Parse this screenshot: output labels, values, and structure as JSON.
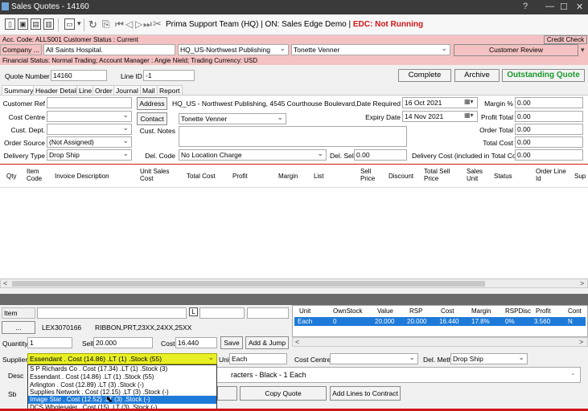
{
  "window": {
    "title": "Sales Quotes - 14160",
    "help": "?",
    "minimize": "—",
    "maximize": "☐",
    "close": "✕"
  },
  "toolbar": {
    "team": "Prima Support Team (HQ) | ON: Sales Edge Demo | ",
    "edc": "EDC: Not Running"
  },
  "account_bar": {
    "text": "Acc. Code: ALLS001  Customer Status : Current",
    "credit_check": "Credit Check"
  },
  "company_row": {
    "company_label": "Company ...",
    "company": "All Saints Hospital.",
    "branch": "HQ_US-Northwest Publishing",
    "contact": "Tonette Venner",
    "review": "Customer Review"
  },
  "financial_bar": {
    "text": "Financial Status: Normal Trading;  Account Manager : Angie Nield; Trading Currency: USD"
  },
  "quote": {
    "number_label": "Quote Number",
    "number": "14160",
    "line_id_label": "Line ID",
    "line_id": "-1",
    "complete": "Complete",
    "archive": "Archive",
    "status": "Outstanding Quote"
  },
  "tabs": [
    "Summary",
    "Header Detail",
    "Line",
    "Order",
    "Journal",
    "Mail",
    "Report"
  ],
  "summary": {
    "customer_ref_label": "Customer Ref",
    "cost_centre_label": "Cost Centre",
    "cust_dept_label": "Cust. Dept.",
    "order_source_label": "Order Source",
    "order_source": "(Not Assigned)",
    "delivery_type_label": "Delivery Type",
    "delivery_type": "Drop Ship",
    "address_btn": "Address",
    "address": "HQ_US - Northwest Publishing, 4545 Courthouse Boulevard,",
    "contact_btn": "Contact",
    "contact": "Tonette Venner",
    "cust_notes_label": "Cust. Notes",
    "del_code_label": "Del. Code",
    "del_code": "No Location Charge",
    "del_sell_label": "Del. Sell",
    "del_sell": "0.00",
    "date_required_label": "Date Required",
    "date_required": "16 Oct 2021",
    "expiry_label": "Expiry Date",
    "expiry": "14 Nov 2021",
    "margin_label": "Margin %",
    "margin": "0.00",
    "profit_total_label": "Profit Total",
    "profit_total": "0.00",
    "order_total_label": "Order Total",
    "order_total": "0.00",
    "total_cost_label": "Total Cost",
    "total_cost": "0.00",
    "delivery_cost_label": "Delivery Cost (included in Total Cost)",
    "delivery_cost": "0.00"
  },
  "grid": {
    "columns": [
      "Qty",
      "Item Code",
      "Invoice Description",
      "Unit Sales Cost",
      "Total Cost",
      "Profit",
      "Margin",
      "List",
      "Sell Price",
      "Discount",
      "Total Sell Price",
      "Sales Unit",
      "Status",
      "Order Line Id",
      "Sup"
    ]
  },
  "item": {
    "item_label": "Item",
    "code": "LEX3070166",
    "description": "RIBBON,PRT,23XX,24XX,25XX",
    "flag": "L",
    "browse": "...",
    "quantity_label": "Quantity",
    "quantity": "1",
    "sell_label": "Sell",
    "sell": "20.000",
    "cost_label": "Cost",
    "cost": "16.440",
    "save": "Save",
    "add_jump": "Add & Jump",
    "supplier_label": "Supplier",
    "supplier": "Essendant . Cost (14.86) .LT (1) .Stock (55)",
    "unit_label": "Unit",
    "unit": "Each",
    "cost_centre_label": "Cost Centre",
    "del_method_label": "Del. Method",
    "del_method": "Drop Ship",
    "desc_label": "Desc",
    "desc": "racters - Black - 1 Each",
    "sb_label": "Sb",
    "copy_quote": "Copy Quote",
    "add_lines": "Add Lines to Contract"
  },
  "stock": {
    "columns": [
      "Unit",
      "OwnStock",
      "Value",
      "RSP",
      "Cost",
      "Margin",
      "RSPDisc",
      "Profit",
      "Cont"
    ],
    "row": [
      "Each",
      "0",
      "20.000",
      "20.000",
      "16.440",
      "17.8%",
      "0%",
      "3.560",
      "N"
    ]
  },
  "supplier_options": [
    "S P Richards Co . Cost (17.34) .LT (1) .Stock (3)",
    "Essendant . Cost (14.86) .LT (1) .Stock (55)",
    "Arlington . Cost (12.89) .LT (3) .Stock (-)",
    "Supplies Network . Cost (12.15) .LT (3) .Stock (-)",
    "Image Star . Cost (12.52) .LT (3) .Stock (-)",
    "DCS Wholesaler . Cost (15) .LT (3) .Stock (-)"
  ],
  "selected_option_index": 4
}
